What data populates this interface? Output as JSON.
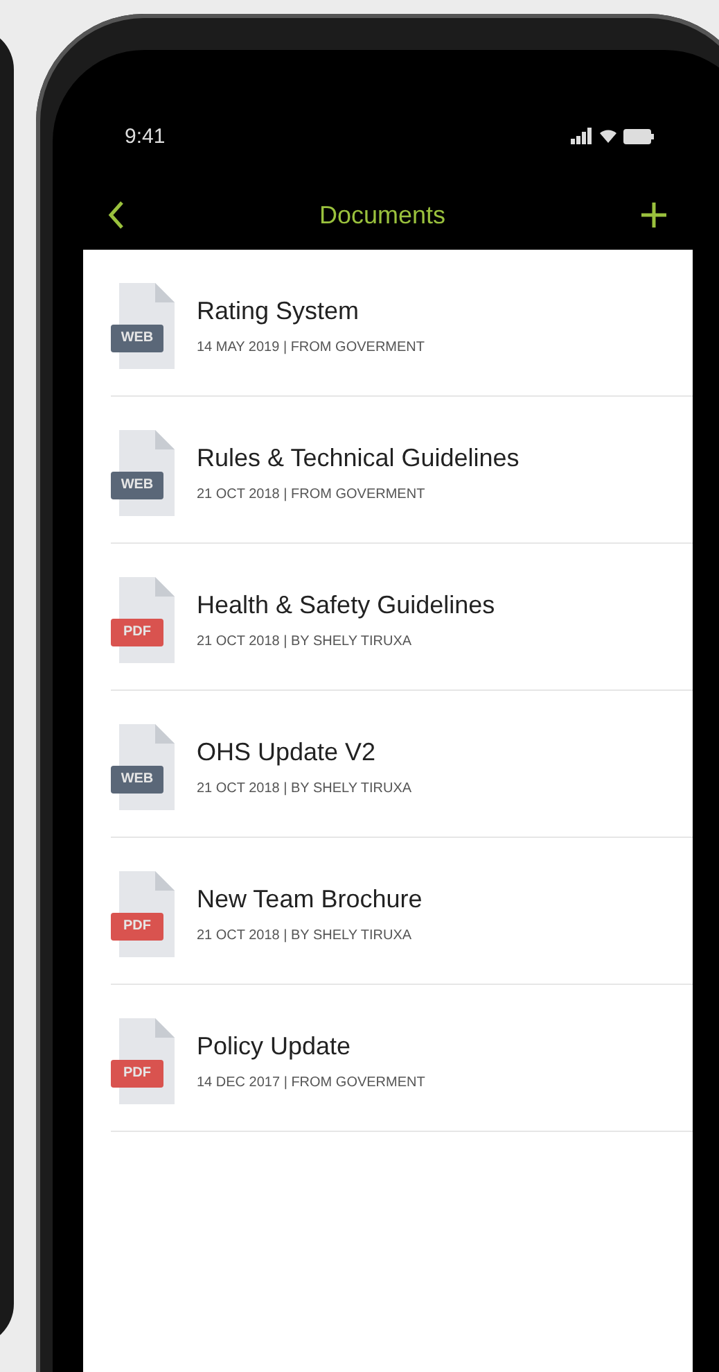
{
  "status_bar": {
    "time": "9:41"
  },
  "nav_bar": {
    "title": "Documents"
  },
  "documents": [
    {
      "kind": "web",
      "badge": "WEB",
      "title": "Rating System",
      "meta": "14 MAY 2019 | FROM GOVERMENT"
    },
    {
      "kind": "web",
      "badge": "WEB",
      "title": "Rules & Technical Guidelines",
      "meta": "21 OCT 2018 | FROM GOVERMENT"
    },
    {
      "kind": "pdf",
      "badge": "PDF",
      "title": "Health & Safety Guidelines",
      "meta": "21 OCT 2018 | BY SHELY TIRUXA"
    },
    {
      "kind": "web",
      "badge": "WEB",
      "title": "OHS Update V2",
      "meta": "21 OCT 2018 | BY SHELY TIRUXA"
    },
    {
      "kind": "pdf",
      "badge": "PDF",
      "title": "New Team Brochure",
      "meta": "21 OCT 2018 | BY SHELY TIRUXA"
    },
    {
      "kind": "pdf",
      "badge": "PDF",
      "title": "Policy Update",
      "meta": "14 DEC 2017 | FROM GOVERMENT"
    }
  ]
}
